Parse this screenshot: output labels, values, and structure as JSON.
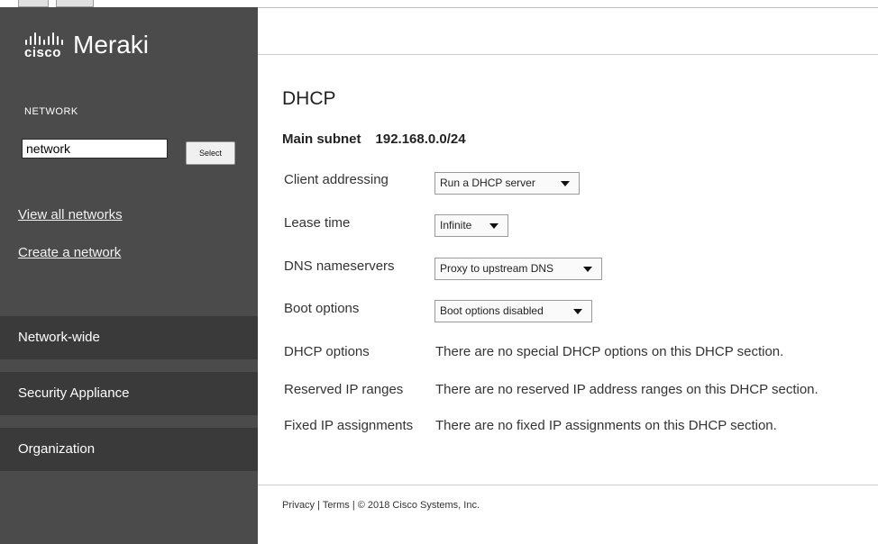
{
  "colors": {
    "sidebar": "#4b4b4b",
    "sidebar_nav": "#3a3a3a",
    "text": "#333333"
  },
  "sidebar": {
    "logo_cisco": "cisco",
    "logo_meraki": "Meraki",
    "network_label": "NETWORK",
    "network_input_value": "network",
    "select_label": "Select",
    "links": {
      "view_all": "View all networks",
      "create": "Create a network"
    },
    "nav": [
      "Network-wide",
      "Security Appliance",
      "Organization"
    ]
  },
  "main": {
    "title": "DHCP",
    "subnet_label": "Main subnet",
    "subnet_value": "192.168.0.0/24",
    "rows": {
      "client_addressing": {
        "label": "Client addressing",
        "value": "Run a DHCP server"
      },
      "lease_time": {
        "label": "Lease time",
        "value": "Infinite"
      },
      "dns": {
        "label": "DNS nameservers",
        "value": "Proxy to upstream DNS"
      },
      "boot": {
        "label": "Boot options",
        "value": "Boot options disabled"
      },
      "dhcp_options": {
        "label": "DHCP options",
        "value": "There are no special DHCP options on this DHCP section."
      },
      "reserved": {
        "label": "Reserved IP ranges",
        "value": "There are no reserved IP address ranges on this DHCP section."
      },
      "fixed": {
        "label": "Fixed IP assignments",
        "value": "There are no fixed IP assignments on this DHCP section."
      }
    }
  },
  "footer": {
    "text": "Privacy  |  Terms   | © 2018 Cisco Systems, Inc."
  }
}
